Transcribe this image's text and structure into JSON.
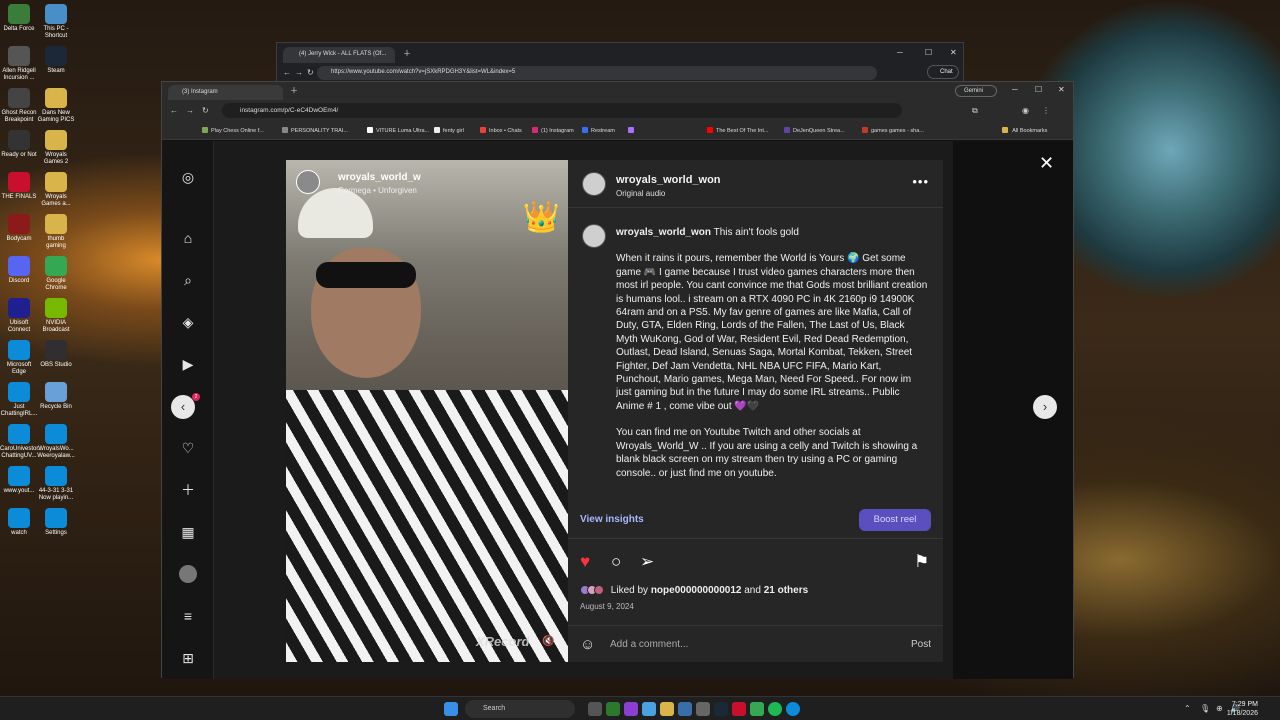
{
  "desktop": {
    "icons": [
      {
        "label": "Delta Force",
        "color": "#3a7d3a"
      },
      {
        "label": "This PC - Shortcut",
        "color": "#4a8ec9"
      },
      {
        "label": "Allen Ridgell Incursion ...",
        "color": "#555555"
      },
      {
        "label": "Steam",
        "color": "#1b2838"
      },
      {
        "label": "Ghost Recon Breakpoint",
        "color": "#444444"
      },
      {
        "label": "Dans New Gaming PICS",
        "color": "#d9b44a"
      },
      {
        "label": "Ready or Not",
        "color": "#333333"
      },
      {
        "label": "Wroyals Games 2",
        "color": "#d9b44a"
      },
      {
        "label": "THE FINALS",
        "color": "#c8102e"
      },
      {
        "label": "Wroyals Games a...",
        "color": "#d9b44a"
      },
      {
        "label": "Bodycam",
        "color": "#8b1a1a"
      },
      {
        "label": "thumb gaming",
        "color": "#d9b44a"
      },
      {
        "label": "Discord",
        "color": "#5865f2"
      },
      {
        "label": "Google Chrome",
        "color": "#34a853"
      },
      {
        "label": "Ubisoft Connect",
        "color": "#1f1f8f"
      },
      {
        "label": "NVIDIA Broadcast",
        "color": "#76b900"
      },
      {
        "label": "Microsoft Edge",
        "color": "#0c8bd8"
      },
      {
        "label": "OBS Studio",
        "color": "#302e31"
      },
      {
        "label": "Just ChattingIRL...",
        "color": "#0c8bd8"
      },
      {
        "label": "Recycle Bin",
        "color": "#6aa0d8"
      },
      {
        "label": "CaroUnivestor... ChattingUV...",
        "color": "#0c8bd8"
      },
      {
        "label": "WroyalsWo... Weeroyalaw...",
        "color": "#0c8bd8"
      },
      {
        "label": "www.yout...",
        "color": "#0c8bd8"
      },
      {
        "label": "44-3-31 3-31 Now playin...",
        "color": "#0c8bd8"
      },
      {
        "label": "watch",
        "color": "#0c8bd8"
      },
      {
        "label": "Settings",
        "color": "#0c8bd8"
      }
    ]
  },
  "taskbar": {
    "search_placeholder": "Search",
    "time": "7:29 PM",
    "date": "1/18/2026"
  },
  "youtube_window": {
    "tab_title": "(4) Jerry Wick - ALL FLATS (Of...",
    "url": "https://www.youtube.com/watch?v=jSXkRPDGH3Y&list=WL&index=5",
    "chat_label": "Chat"
  },
  "instagram_window": {
    "tab_title": "(3) Instagram",
    "gemini_label": "Gemini",
    "url": "instagram.com/p/C-eC4DwOEm4/",
    "bookmarks": [
      {
        "label": "Play Chess Online f...",
        "color": "#7fa650"
      },
      {
        "label": "PERSONALITY TRAI...",
        "color": "#888888"
      },
      {
        "label": "VITURE Luma Ultra...",
        "color": "#ffffff"
      },
      {
        "label": "fenty girl",
        "color": "#eeeeee"
      },
      {
        "label": "Inbox • Chats",
        "color": "#ea4335"
      },
      {
        "label": "(1) Instagram",
        "color": "#d62976"
      },
      {
        "label": "Restream",
        "color": "#3b6cf6"
      },
      {
        "label": "",
        "color": "#a970ff"
      },
      {
        "label": "The Best Of The Int...",
        "color": "#ff0000"
      },
      {
        "label": "DeJenQueen Strea...",
        "color": "#6441a5"
      },
      {
        "label": "games games - sha...",
        "color": "#c0392b"
      }
    ],
    "all_bookmarks": "All Bookmarks"
  },
  "post": {
    "username": "wroyals_world_won",
    "audio": "Original audio",
    "video_username": "wroyals_world_w",
    "video_song": "Cormega • Unforgiven",
    "video_watermark": "XRecord",
    "caption_first": "This ain't fools gold",
    "caption_body": "When it rains it pours, remember the World is Yours 🌍 Get some game 🎮 I game because I trust video games characters more then most irl people. You cant convince me that Gods most brilliant creation is humans lool.. i stream on a RTX 4090 PC in 4K 2160p i9 14900K 64ram and on a PS5. My fav genre of games are like Mafia, Call of Duty, GTA, Elden Ring, Lords of the Fallen, The Last of Us, Black Myth WuKong, God of War, Resident Evil, Red Dead Redemption, Outlast, Dead Island, Senuas Saga, Mortal Kombat, Tekken, Street Fighter, Def Jam Vendetta, NHL NBA UFC FIFA, Mario Kart, Punchout, Mario games, Mega Man, Need For Speed.. For now im just gaming but in the future I may do some IRL streams.. Public Anime # 1 , come vibe out 💜🖤",
    "caption_body2": "You can find me on Youtube Twitch and other socials at Wroyals_World_W .. If you are using a celly and Twitch is showing a blank black screen on my stream then try using a PC or gaming console.. or just find me on youtube.",
    "view_insights": "View insights",
    "boost_reel": "Boost reel",
    "liked_by_prefix": "Liked by",
    "liked_by_user": "nope000000000012",
    "liked_by_and": "and",
    "liked_by_others": "21 others",
    "date": "August 9, 2024",
    "comment_placeholder": "Add a comment...",
    "post_button": "Post",
    "notification_count": "2"
  }
}
